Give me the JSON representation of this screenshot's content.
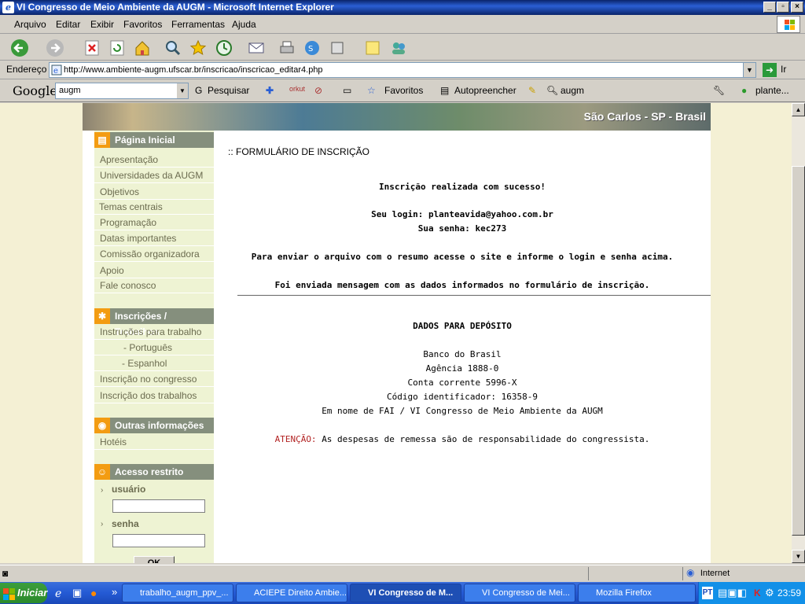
{
  "window": {
    "title": "VI Congresso de Meio Ambiente da AUGM - Microsoft Internet Explorer"
  },
  "menu": [
    "Arquivo",
    "Editar",
    "Exibir",
    "Favoritos",
    "Ferramentas",
    "Ajuda"
  ],
  "address": {
    "label": "Endereço",
    "url": "http://www.ambiente-augm.ufscar.br/inscricao/inscricao_editar4.php",
    "go": "Ir"
  },
  "google_bar": {
    "logo": "Google",
    "query": "augm",
    "search": "Pesquisar",
    "favorites": "Favoritos",
    "autofill": "Autopreencher",
    "highlight": "augm",
    "user": "plante..."
  },
  "banner": {
    "location": "São Carlos - SP - Brasil"
  },
  "sidebar": {
    "sections": [
      {
        "title": "Página Inicial",
        "items": [
          "Apresentação",
          "Universidades da AUGM",
          "Objetivos",
          "Temas centrais",
          "Programação",
          "Datas importantes",
          "Comissão organizadora",
          "Apoio",
          "Fale conosco"
        ]
      },
      {
        "title": "Inscrições / Trabalhos",
        "items": [
          "Instruções para trabalho",
          "- Português",
          "- Espanhol",
          "Inscrição no congresso",
          "Inscrição dos trabalhos"
        ]
      },
      {
        "title": "Outras informações",
        "items": [
          "Hotéis"
        ]
      },
      {
        "title": "Acesso restrito",
        "items": []
      }
    ],
    "login": {
      "user_label": "usuário",
      "pass_label": "senha",
      "ok": "OK"
    }
  },
  "main": {
    "heading": ":: FORMULÁRIO DE INSCRIÇÃO",
    "success": "Inscrição realizada com sucesso!",
    "login_line": "Seu login: planteavida@yahoo.com.br",
    "password_line": "Sua senha: kec273",
    "instructions": "Para enviar o arquivo com o resumo acesse o site e informe o login e senha acima.",
    "email_sent": "Foi enviada mensagem com as dados informados no formulário de inscrição.",
    "deposit_title": "DADOS PARA DEPÓSITO",
    "bank": "Banco do Brasil",
    "agency": "Agência 1888-0",
    "account": "Conta corrente 5996-X",
    "identifier": "Código identificador: 16358-9",
    "holder": "Em nome de FAI / VI Congresso de Meio Ambiente da AUGM",
    "attention_label": "ATENÇÃO:",
    "attention_text": "As despesas de remessa são de responsabilidade do congressista."
  },
  "status": {
    "zone": "Internet"
  },
  "taskbar": {
    "start": "Iniciar",
    "tasks": [
      "trabalho_augm_ppv_...",
      "ACIEPE Direito Ambie...",
      "VI Congresso de M...",
      "VI Congresso de Mei...",
      "Mozilla Firefox"
    ],
    "clock": "23:59",
    "lang": "PT"
  },
  "colors": {
    "accent": "#f39c12",
    "sidebar_header": "#858f7d",
    "sidebar_bg": "#eef3d3",
    "attention": "#b22222"
  }
}
